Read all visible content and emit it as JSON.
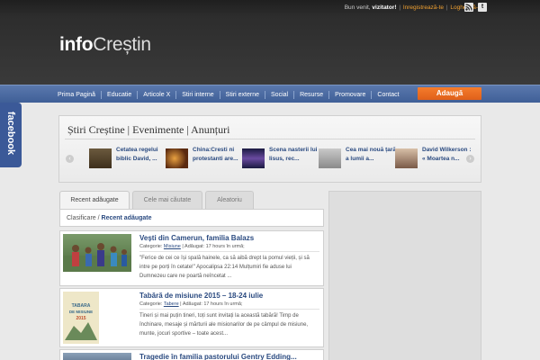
{
  "topbar": {
    "welcome": "Bun venit, ",
    "user": "vizitator!",
    "register": "Inregistrează-te",
    "separator": "|",
    "login": "Loghează-te",
    "rss_icon": "rss-icon",
    "twitter_icon": "twitter-icon",
    "twitter_glyph": "t"
  },
  "logo": {
    "part1": "info",
    "part2": "Creștin"
  },
  "nav": {
    "items": [
      "Prima Pagină",
      "Educatie",
      "Articole X",
      "Stiri interne",
      "Stiri externe",
      "Social",
      "Resurse",
      "Promovare",
      "Contact"
    ],
    "add_button": "Adaugă"
  },
  "facebook": {
    "label": "facebook"
  },
  "news": {
    "title": "Știri Creștine | Evenimente | Anunțuri",
    "prev": "‹",
    "next": "›",
    "items": [
      {
        "caption": "Cetatea regelui biblic David, ..."
      },
      {
        "caption": "China:Cresti ni protestanti are..."
      },
      {
        "caption": "Scena nasterii lui Iisus, rec..."
      },
      {
        "caption": "Cea mai nouă țară a lumii a..."
      },
      {
        "caption": "David Wilkerson : « Moartea n..."
      }
    ]
  },
  "tabs": [
    "Recent adăugate",
    "Cele mai căutate",
    "Aleatoriu"
  ],
  "breadcrumb": {
    "root": "Clasificare / ",
    "current": "Recent adăugate"
  },
  "posts": [
    {
      "title": "Vești din Camerun, familia Balazs",
      "category_label": "Categorie: ",
      "category": "Misiune",
      "added": " | Adăugat: 17 hours în urmă;",
      "excerpt": "\"Ferice de cei ce își spală hainele, ca să aibă drept la pomul vieții, și să intre pe porți în cetate!\" Apocalipsa 22:14 Mulțumiri fie aduse lui Dumnezeu care ne poartă neîncetat ..."
    },
    {
      "title": "Tabără de misiune 2015 – 18-24 iulie",
      "category_label": "Categorie: ",
      "category": "Tabere",
      "added": " | Adăugat: 17 hours în urmă;",
      "excerpt": "Tineri și mai puțin tineri, toți sunt invitați la această tabără! Timp de închinare, mesaje și mărturii ale misionarilor de pe câmpul de misiune, munte, jocuri sportive – toate acest..."
    },
    {
      "title": "Tragedie în familia pastorului Gentry Edding...",
      "category_label": "",
      "category": "",
      "added": "",
      "excerpt": ""
    }
  ],
  "poster_text": [
    "TABARA",
    "DE MISIUNE",
    "2015"
  ]
}
